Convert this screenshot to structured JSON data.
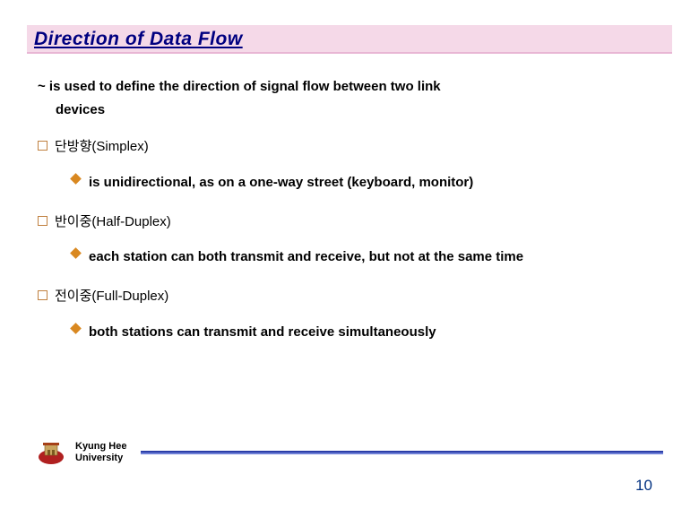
{
  "title": "Direction of Data Flow",
  "intro_line1": "~ is used to define the direction of signal flow between two link",
  "intro_line2": "devices",
  "items": [
    {
      "label": "단방향(Simplex)",
      "detail": "is unidirectional, as on a one-way street (keyboard, monitor)"
    },
    {
      "label": "반이중(Half-Duplex)",
      "detail": "each station can both transmit and receive, but not at the same time"
    },
    {
      "label": "전이중(Full-Duplex)",
      "detail": "both stations can transmit and receive simultaneously"
    }
  ],
  "footer": {
    "university_line1": "Kyung Hee",
    "university_line2": "University",
    "page_number": "10"
  }
}
